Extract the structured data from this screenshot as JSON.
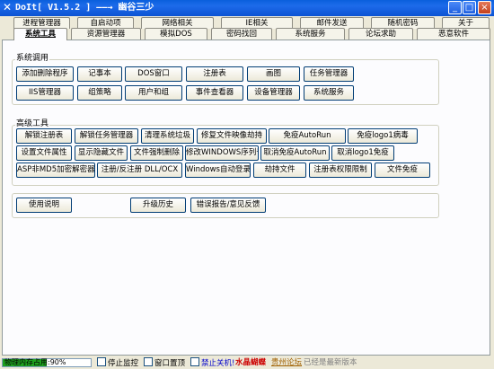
{
  "window": {
    "title": "DoIt[ V1.5.2 ] ——→ 幽谷三少",
    "minimize_label": "_",
    "maximize_label": "□",
    "close_label": "×"
  },
  "tabs_back": [
    "进程管理器",
    "自启动项",
    "网络相关",
    "IE相关",
    "邮件发送",
    "随机密码",
    "关于"
  ],
  "tabs_front": [
    "系统工具",
    "资源管理器",
    "模拟DOS",
    "密码找回",
    "系统服务",
    "论坛求助",
    "恶意软件"
  ],
  "groups": {
    "common": {
      "title": "系统调用",
      "row1": [
        "添加删除程序",
        "记事本",
        "DOS窗口",
        "注册表",
        "画图",
        "任务管理器"
      ],
      "row2": [
        "IIS管理器",
        "组策略",
        "用户和组",
        "事件查看器",
        "设备管理器",
        "系统服务"
      ]
    },
    "advanced": {
      "title": "高级工具",
      "row1": [
        "解锁注册表",
        "解锁任务管理器",
        "清理系统垃圾",
        "修复文件映像劫持",
        "免疫AutoRun",
        "免疫logo1病毒"
      ],
      "row2": [
        "设置文件属性",
        "显示隐藏文件",
        "文件强制删除",
        "修改WINDOWS序列号",
        "取消免疫AutoRun",
        "取消logo1免疫"
      ],
      "row3": [
        "ASP非MD5加密解密器",
        "注册/反注册 DLL/OCX",
        "Windows自动登录",
        "劫持文件",
        "注册表权限限制",
        "文件免疫"
      ]
    },
    "misc": {
      "buttons": [
        "使用说明",
        "升级历史",
        "错误报告/意见反馈"
      ]
    }
  },
  "status": {
    "memory_label": "物理内存占用:",
    "memory_percent_text": "90%",
    "memory_fraction": 0.5,
    "stop_monitor": "停止监控",
    "window_top": "窗口置顶",
    "disable_shutdown": "禁止关机!",
    "author": "水晶蝴蝶",
    "forum": "贵州论坛",
    "version_note": "已经是最新版本"
  },
  "colors": {
    "titlebar": "#0c53d3",
    "memory_bar": "#1ea11e",
    "shutdown_text": "#0000cc",
    "author_text": "#cc0000",
    "forum_text": "#a06000",
    "version_text": "#808080"
  }
}
